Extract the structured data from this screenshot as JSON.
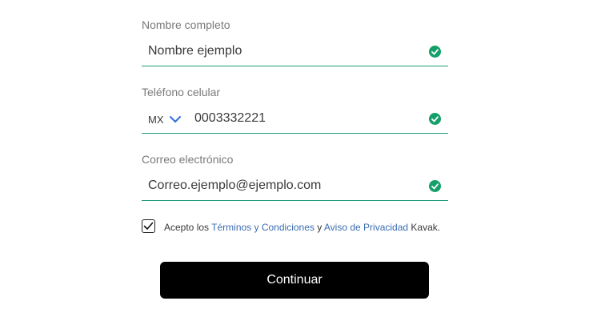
{
  "form": {
    "name": {
      "label": "Nombre completo",
      "value": "Nombre ejemplo",
      "status_icon": "check-circle-icon"
    },
    "phone": {
      "label": "Teléfono celular",
      "country_code": "MX",
      "value": "0003332221",
      "status_icon": "check-circle-icon"
    },
    "email": {
      "label": "Correo electrónico",
      "value": "Correo.ejemplo@ejemplo.com",
      "status_icon": "check-circle-icon"
    }
  },
  "terms": {
    "checked": true,
    "prefix": "Acepto los ",
    "terms_link": "Términos y Condiciones",
    "connector": " y ",
    "privacy_link": "Aviso de Privacidad",
    "suffix": " Kavak."
  },
  "continue_label": "Continuar",
  "colors": {
    "valid_green": "#15a06a",
    "underline_green": "#1c9b7a",
    "link_blue": "#3b6db3",
    "button_bg": "#000000"
  }
}
